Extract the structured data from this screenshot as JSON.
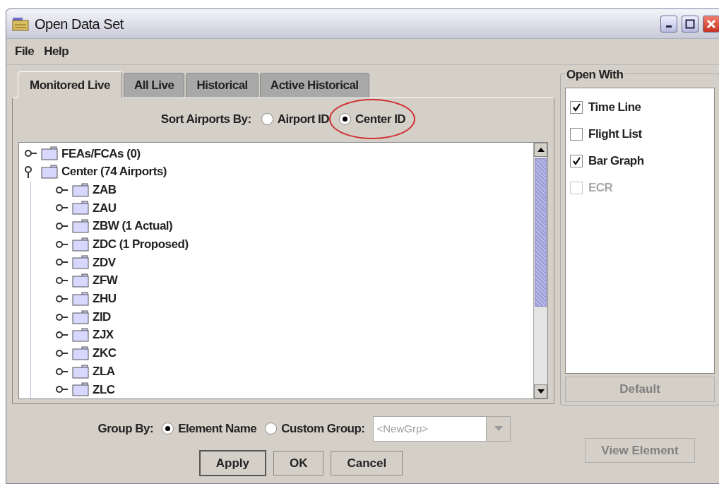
{
  "window": {
    "title": "Open Data Set"
  },
  "menu": [
    {
      "label": "File"
    },
    {
      "label": "Help"
    }
  ],
  "tabs": [
    {
      "label": "Monitored Live",
      "selected": true
    },
    {
      "label": "All Live",
      "selected": false
    },
    {
      "label": "Historical",
      "selected": false
    },
    {
      "label": "Active Historical",
      "selected": false
    }
  ],
  "sort": {
    "label": "Sort Airports By:",
    "options": [
      {
        "label": "Airport ID",
        "selected": false,
        "highlighted": false
      },
      {
        "label": "Center ID",
        "selected": true,
        "highlighted": true
      }
    ]
  },
  "tree": [
    {
      "label": "FEAs/FCAs (0)",
      "expanded": false
    },
    {
      "label": "Center (74 Airports)",
      "expanded": true,
      "children": [
        {
          "label": "ZAB",
          "expanded": false
        },
        {
          "label": "ZAU",
          "expanded": false
        },
        {
          "label": "ZBW (1 Actual)",
          "expanded": false
        },
        {
          "label": "ZDC (1 Proposed)",
          "expanded": false
        },
        {
          "label": "ZDV",
          "expanded": false
        },
        {
          "label": "ZFW",
          "expanded": false
        },
        {
          "label": "ZHU",
          "expanded": false
        },
        {
          "label": "ZID",
          "expanded": false
        },
        {
          "label": "ZJX",
          "expanded": false
        },
        {
          "label": "ZKC",
          "expanded": false
        },
        {
          "label": "ZLA",
          "expanded": false
        },
        {
          "label": "ZLC",
          "expanded": false
        }
      ]
    }
  ],
  "open_with": {
    "title": "Open With",
    "options": [
      {
        "label": "Time Line",
        "checked": true,
        "disabled": false
      },
      {
        "label": "Flight List",
        "checked": false,
        "disabled": false
      },
      {
        "label": "Bar Graph",
        "checked": true,
        "disabled": false
      },
      {
        "label": "ECR",
        "checked": false,
        "disabled": true
      }
    ],
    "default_button": {
      "label": "Default",
      "disabled": true
    }
  },
  "group_by": {
    "label": "Group By:",
    "options": [
      {
        "label": "Element Name",
        "selected": true
      },
      {
        "label": "Custom Group:",
        "selected": false
      }
    ],
    "combo": {
      "value": "<NewGrp>",
      "disabled": true
    }
  },
  "buttons": [
    {
      "label": "Apply",
      "focused": true
    },
    {
      "label": "OK",
      "focused": false
    },
    {
      "label": "Cancel",
      "focused": false
    }
  ],
  "view_element": {
    "label": "View Element",
    "disabled": true
  }
}
